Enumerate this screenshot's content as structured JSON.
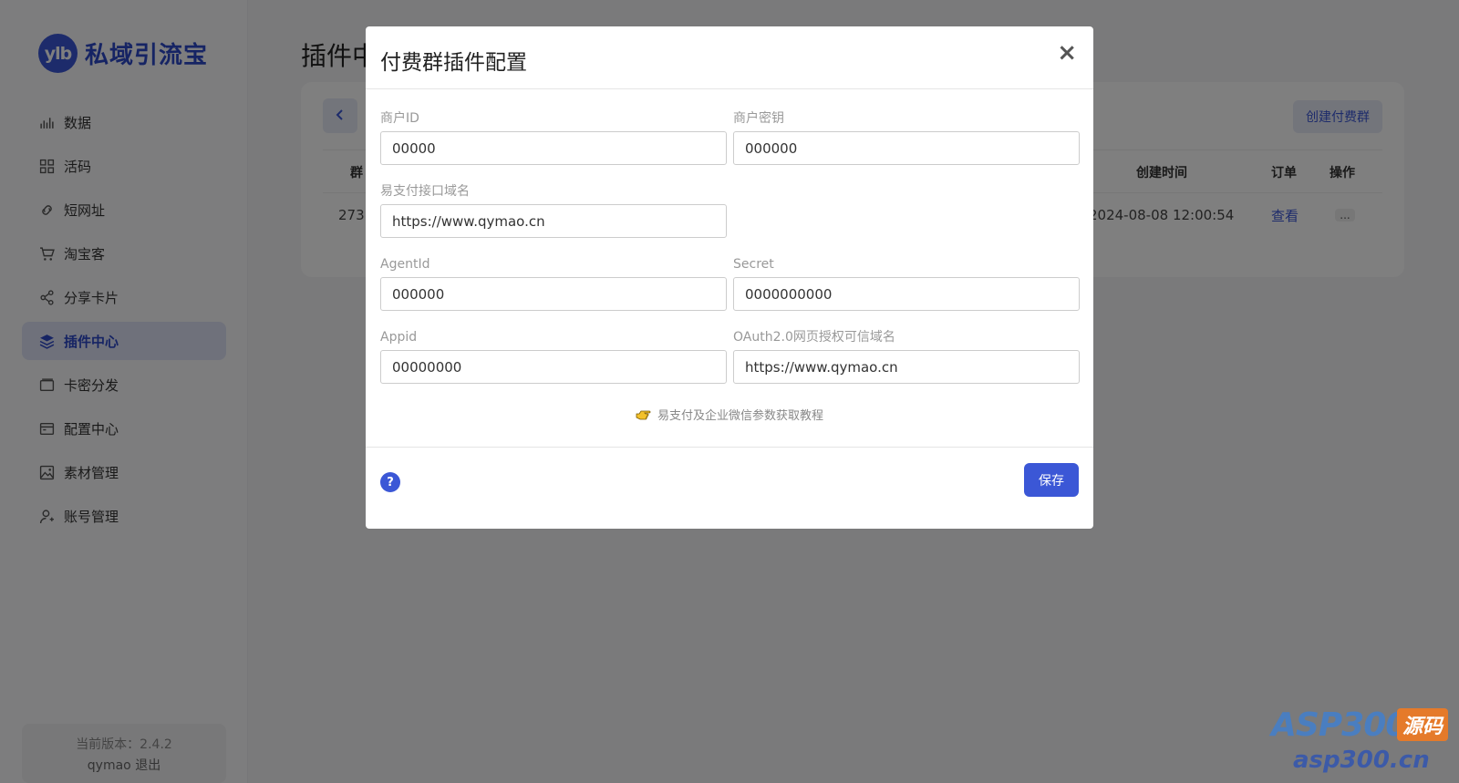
{
  "app": {
    "logo_badge": "ylb",
    "logo_text": "私域引流宝"
  },
  "sidebar": {
    "items": [
      {
        "label": "数据",
        "icon": "chart-icon"
      },
      {
        "label": "活码",
        "icon": "qrcode-icon"
      },
      {
        "label": "短网址",
        "icon": "link-icon"
      },
      {
        "label": "淘宝客",
        "icon": "cart-icon"
      },
      {
        "label": "分享卡片",
        "icon": "share-icon"
      },
      {
        "label": "插件中心",
        "icon": "layers-icon",
        "active": true
      },
      {
        "label": "卡密分发",
        "icon": "card-icon"
      },
      {
        "label": "配置中心",
        "icon": "config-icon"
      },
      {
        "label": "素材管理",
        "icon": "image-icon"
      },
      {
        "label": "账号管理",
        "icon": "user-icon"
      }
    ],
    "version_label": "当前版本：2.4.2",
    "username": "qymao",
    "logout": "退出"
  },
  "main": {
    "title": "插件中",
    "create_button": "创建付费群",
    "table": {
      "headers": {
        "group": "群",
        "created": "创建时间",
        "orders": "订单",
        "actions": "操作"
      },
      "row": {
        "id": "273",
        "created": "2024-08-08 12:00:54",
        "view": "查看",
        "more": "..."
      }
    }
  },
  "modal": {
    "title": "付费群插件配置",
    "close": "×",
    "fields": {
      "merchant_id": {
        "label": "商户ID",
        "value": "00000"
      },
      "merchant_key": {
        "label": "商户密钥",
        "value": "000000"
      },
      "pay_domain": {
        "label": "易支付接口域名",
        "value": "https://www.qymao.cn"
      },
      "agent_id": {
        "label": "AgentId",
        "value": "000000"
      },
      "secret": {
        "label": "Secret",
        "value": "0000000000"
      },
      "appid": {
        "label": "Appid",
        "value": "00000000"
      },
      "oauth_domain": {
        "label": "OAuth2.0网页授权可信域名",
        "value": "https://www.qymao.cn"
      }
    },
    "tutorial": "易支付及企业微信参数获取教程",
    "help": "?",
    "save": "保存"
  },
  "watermark": {
    "main": "ASP300",
    "tag": "源码",
    "sub": "asp300.cn"
  },
  "colors": {
    "primary": "#3b57d6",
    "active_bg": "#dfe3f6"
  }
}
